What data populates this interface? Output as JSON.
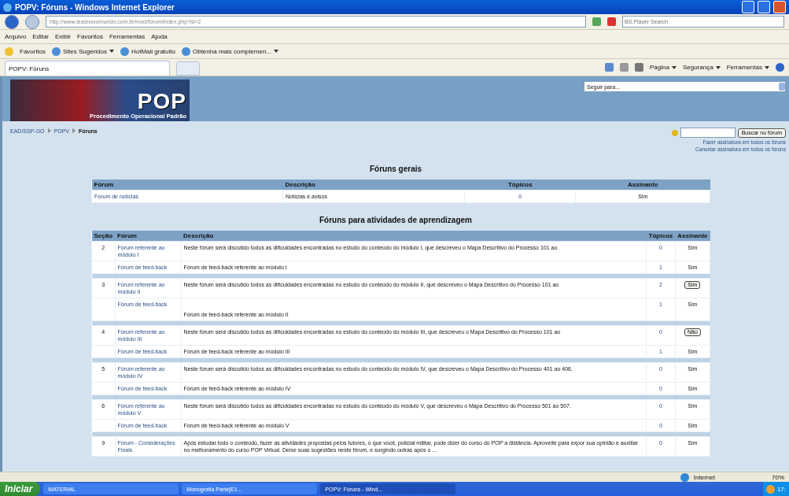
{
  "window": {
    "title": "POPV: Fóruns - Windows Internet Explorer"
  },
  "address_bar": {
    "url": "http://www.ieadnovomundo.com.br/mod/forum/index.php?id=2",
    "search_placeholder": "BS.Player Search"
  },
  "menu": [
    "Arquivo",
    "Editar",
    "Exibir",
    "Favoritos",
    "Ferramentas",
    "Ajuda"
  ],
  "favorites_bar": {
    "favorites": "Favoritos",
    "links": [
      {
        "label": "Sites Sugeridos",
        "dropdown": true
      },
      {
        "label": "HotMail gratuito",
        "dropdown": false
      },
      {
        "label": "Obtenha mais complemen...",
        "dropdown": true
      }
    ]
  },
  "tabs": [
    {
      "label": "POPV: Fóruns",
      "selected": true
    }
  ],
  "command_bar": [
    "Página",
    "Segurança",
    "Ferramentas"
  ],
  "page": {
    "logo": {
      "title": "POP",
      "subtitle": "Procedimento Operacional Padrão"
    },
    "jump_select": "Seguir para...",
    "breadcrumb": [
      "EAD/SSP-GO",
      "POPV",
      "Fóruns"
    ],
    "search_button": "Buscar no fórum",
    "subscribe_links": [
      "Fazer assinatura em todos os fóruns",
      "Cancelar assinatura em todos os fóruns"
    ],
    "general": {
      "heading": "Fóruns gerais",
      "columns": [
        "Fórum",
        "Descrição",
        "Tópicos",
        "Assinante"
      ],
      "rows": [
        {
          "forum": "Fórum de notícias",
          "description": "Notícias e avisos",
          "topics": "0",
          "subscribed": "Sim"
        }
      ]
    },
    "learning": {
      "heading": "Fóruns para atividades de aprendizagem",
      "columns": [
        "Seção",
        "Fórum",
        "Descrição",
        "Tópicos",
        "Assinante"
      ],
      "sections": [
        {
          "section": "2",
          "rows": [
            {
              "forum": "Fórum referente ao módulo I",
              "description": "Neste fórum será discutido todos as dificuldades encontradas no estudo do conteúdo do módulo I, que descreveu o Mapa Descritivo do Processo 101 ao",
              "topics": "0",
              "subscribed": "Sim",
              "kind": "text"
            },
            {
              "forum": "Fórum de feed-back",
              "description": "Fórum de feed-back referente ao módulo I",
              "topics": "1",
              "subscribed": "Sim",
              "kind": "text"
            }
          ]
        },
        {
          "section": "3",
          "rows": [
            {
              "forum": "Fórum referente ao módulo II",
              "description": "Neste fórum será discutido todos as dificuldades encontradas no estudo do conteúdo do módulo II, que descreveu o Mapa Descritivo do Processo 101 ao",
              "topics": "2",
              "subscribed": "Sim",
              "kind": "button"
            },
            {
              "forum": "Fórum de feed-back",
              "description": "Fórum de feed-back referente ao módulo II",
              "topics": "1",
              "subscribed": "Sim",
              "kind": "text"
            }
          ]
        },
        {
          "section": "4",
          "rows": [
            {
              "forum": "Fórum referente ao módulo III",
              "description": "Neste fórum será discutido todos as dificuldades encontradas no estudo do conteúdo do módulo III, que descreveu o Mapa Descritivo do Processo 101 ao",
              "topics": "0",
              "subscribed": "Não",
              "kind": "button"
            },
            {
              "forum": "Fórum de feed-back",
              "description": "Fórum de feed-back referente ao módulo III",
              "topics": "1",
              "subscribed": "Sim",
              "kind": "text"
            }
          ]
        },
        {
          "section": "5",
          "rows": [
            {
              "forum": "Fórum referente ao módulo IV",
              "description": "Neste fórum será discutido todos as dificuldades encontradas no estudo do conteúdo do módulo IV, que descreveu o Mapa Descritivo do Processo 401 ao 406.",
              "topics": "0",
              "subscribed": "Sim",
              "kind": "text"
            },
            {
              "forum": "Fórum de feed-back",
              "description": "Fórum de feed-back referente ao módulo IV",
              "topics": "0",
              "subscribed": "Sim",
              "kind": "text"
            }
          ]
        },
        {
          "section": "6",
          "rows": [
            {
              "forum": "Fórum referente ao módulo V",
              "description": "Neste fórum será discutido todos as dificuldades encontradas no estudo do conteúdo do módulo V, que descreveu o Mapa Descritivo do Processo 501 ao 507.",
              "topics": "0",
              "subscribed": "Sim",
              "kind": "text"
            },
            {
              "forum": "Fórum de feed-back",
              "description": "Fórum de feed-back referente ao módulo V",
              "topics": "0",
              "subscribed": "Sim",
              "kind": "text"
            }
          ]
        },
        {
          "section": "9",
          "rows": [
            {
              "forum": "Fórum - Considerações Finais",
              "description": "Após estudar todo o conteúdo, fazer as atividades propostas pelos tutores, o que você, policial militar, pode dizer do curso do POP a distância. Aproveite para expor sua opinião e auxiliar no melhoramento do curso POP Virtual. Deixe suas sugestões neste fórum, e surgindo outras após o ...",
              "topics": "0",
              "subscribed": "Sim",
              "kind": "text"
            }
          ]
        }
      ]
    }
  },
  "status_bar": {
    "zone": "Internet",
    "zoom": "70%"
  },
  "taskbar": {
    "start": "Iniciar",
    "items": [
      {
        "label": "MATERIAL",
        "selected": false
      },
      {
        "label": "Monografia Parte[E1...",
        "selected": false
      },
      {
        "label": "POPV: Fóruns - Wind...",
        "selected": true
      }
    ],
    "clock": "17:"
  }
}
